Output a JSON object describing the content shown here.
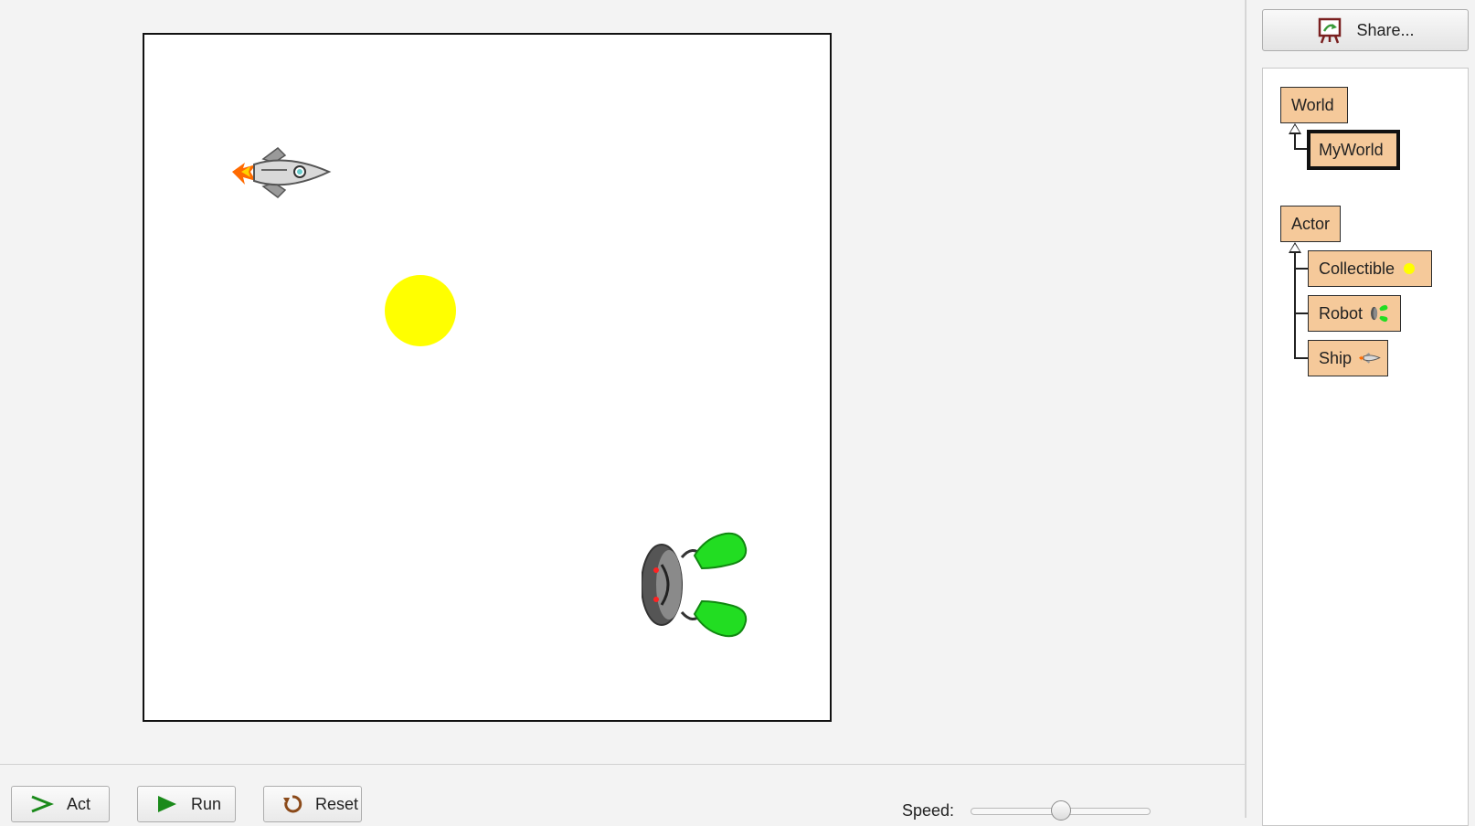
{
  "controls": {
    "act_label": "Act",
    "run_label": "Run",
    "reset_label": "Reset",
    "speed_label": "Speed:",
    "speed_fraction": 0.5
  },
  "share": {
    "label": "Share..."
  },
  "class_tree": {
    "world_classes": [
      {
        "name": "World",
        "selected": false
      },
      {
        "name": "MyWorld",
        "selected": true
      }
    ],
    "actor_classes": [
      {
        "name": "Actor",
        "icon": "none"
      },
      {
        "name": "Collectible",
        "icon": "yellow-dot-icon"
      },
      {
        "name": "Robot",
        "icon": "robot-icon"
      },
      {
        "name": "Ship",
        "icon": "rocket-icon"
      }
    ]
  },
  "world": {
    "actors": [
      "Ship",
      "Collectible",
      "Robot"
    ],
    "colors": {
      "collectible": "#ffff00",
      "robot_claw": "#22dd22",
      "class_box": "#f5c99a"
    }
  }
}
